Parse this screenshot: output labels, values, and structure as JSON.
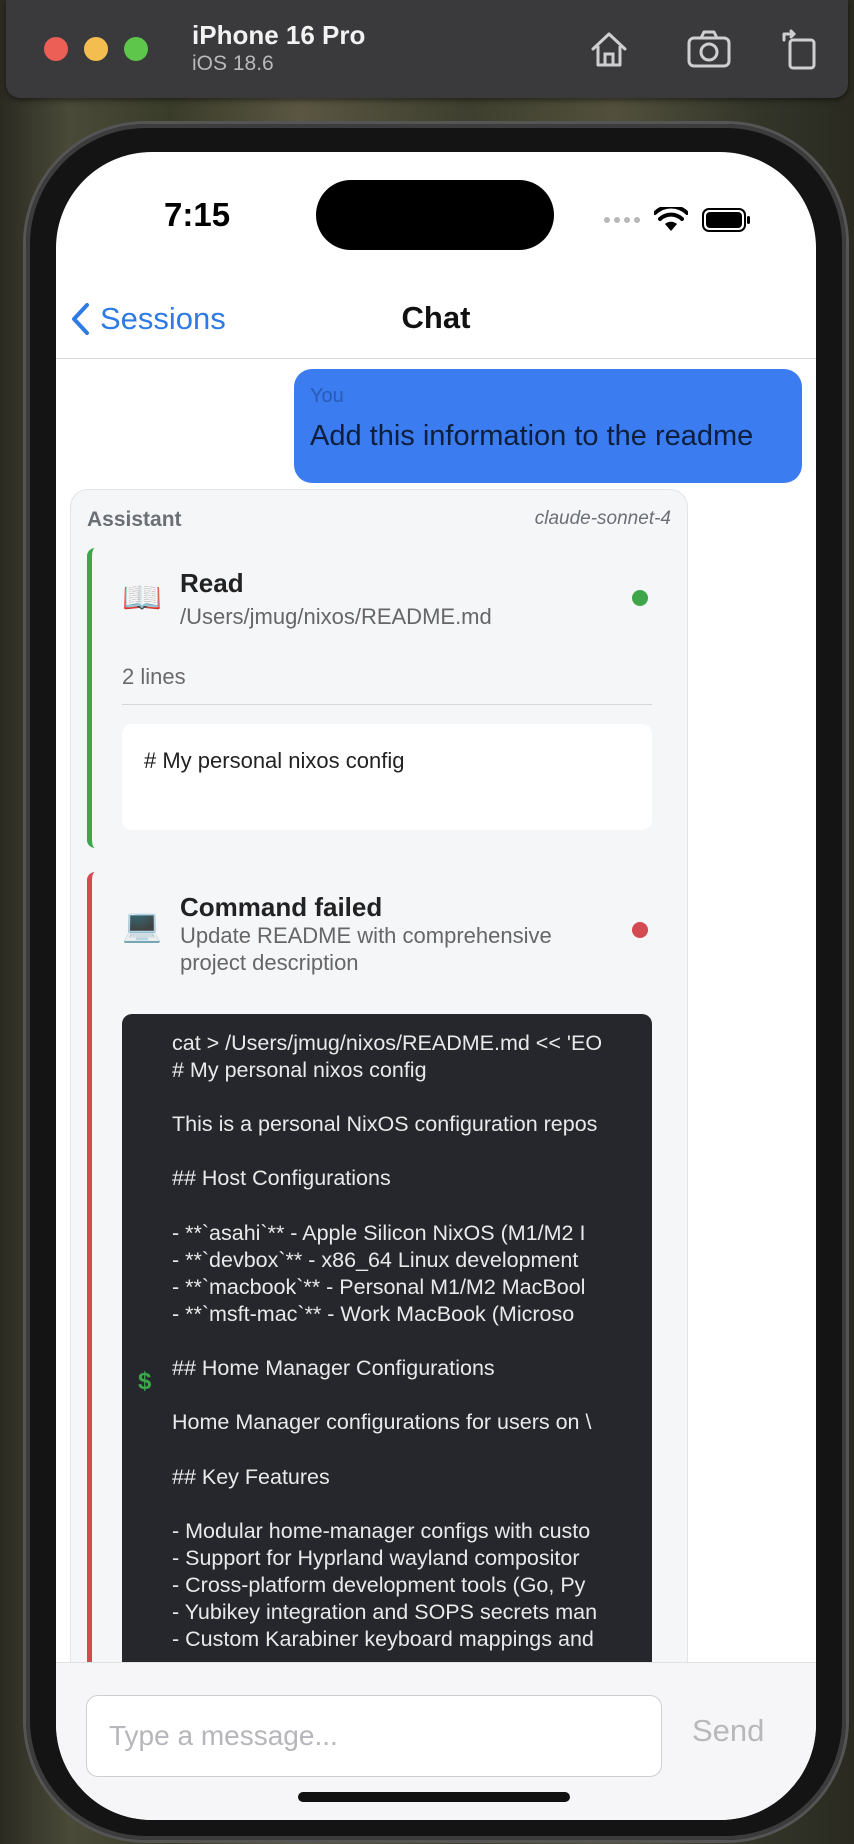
{
  "simulator": {
    "device_name": "iPhone 16 Pro",
    "os_version": "iOS 18.6",
    "buttons": [
      "home-icon",
      "screenshot-camera-icon",
      "rotate-icon"
    ]
  },
  "status_bar": {
    "time": "7:15"
  },
  "nav": {
    "back_label": "Sessions",
    "title": "Chat"
  },
  "messages": {
    "user": {
      "role": "You",
      "text": "Add this information to the readme"
    },
    "assistant": {
      "role": "Assistant",
      "model": "claude-sonnet-4",
      "tools": [
        {
          "name": "Read",
          "icon": "📖",
          "subtitle": "/Users/jmug/nixos/README.md",
          "status": "success",
          "status_color": "#3ea64a",
          "meta": "2 lines",
          "output": "# My personal nixos config"
        },
        {
          "name": "Command failed",
          "icon": "💻",
          "subtitle": "Update README with comprehensive project description",
          "status": "error",
          "status_color": "#d34b50",
          "prompt": "$",
          "command_lines": [
            "cat > /Users/jmug/nixos/README.md << 'EO",
            "# My personal nixos config",
            "",
            "This is a personal NixOS configuration repos",
            "",
            "## Host Configurations",
            "",
            "- **`asahi`** - Apple Silicon NixOS (M1/M2 I",
            "- **`devbox`** - x86_64 Linux development",
            "- **`macbook`** - Personal M1/M2 MacBool",
            "- **`msft-mac`** - Work MacBook (Microso",
            "",
            "## Home Manager Configurations",
            "",
            "Home Manager configurations for users on \\",
            "",
            "## Key Features",
            "",
            "- Modular home-manager configs with custo",
            "- Support for Hyprland wayland compositor",
            "- Cross-platform development tools (Go, Py",
            "- Yubikey integration and SOPS secrets man",
            "- Custom Karabiner keyboard mappings and"
          ]
        }
      ]
    }
  },
  "composer": {
    "placeholder": "Type a message...",
    "send_label": "Send"
  }
}
